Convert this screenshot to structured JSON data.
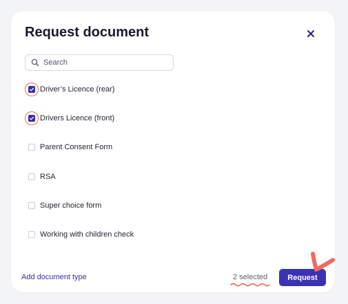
{
  "modal": {
    "title": "Request document",
    "close_icon": "close-icon"
  },
  "search": {
    "placeholder": "Search",
    "value": "",
    "icon": "search-icon"
  },
  "documents": [
    {
      "label": "Driver’s Licence (rear)",
      "checked": true
    },
    {
      "label": "Drivers Licence (front)",
      "checked": true
    },
    {
      "label": "Parent Consent Form",
      "checked": false
    },
    {
      "label": "RSA",
      "checked": false
    },
    {
      "label": "Super choice form",
      "checked": false
    },
    {
      "label": "Working with children check",
      "checked": false
    }
  ],
  "footer": {
    "add_link": "Add document type",
    "selected_text": "2 selected",
    "request_label": "Request"
  },
  "colors": {
    "accent": "#3b32b3",
    "annotation": "#e86b5e"
  }
}
